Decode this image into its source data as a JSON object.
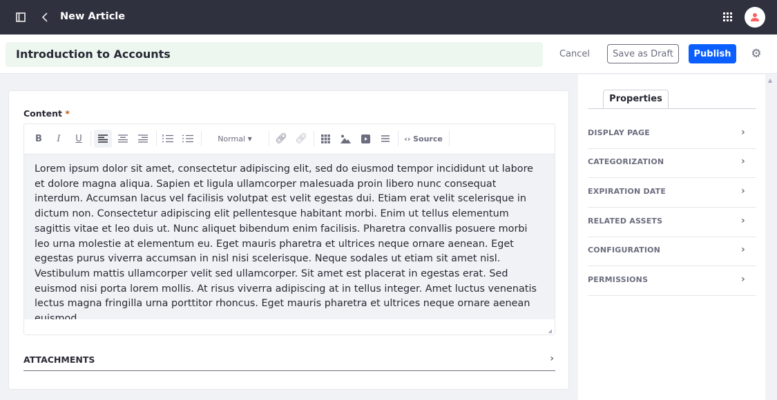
{
  "topbar": {
    "title": "New Article",
    "icons": [
      "sidebar-toggle-icon",
      "back-chevron-icon",
      "apps-grid-icon",
      "user-avatar-icon"
    ],
    "avatar_color": "#ff5f5f"
  },
  "header": {
    "title_value": "Introduction to Accounts",
    "cancel": "Cancel",
    "save_draft": "Save as Draft",
    "publish": "Publish",
    "accent": "#0b5fff"
  },
  "content": {
    "label": "Content",
    "required": "*",
    "format_select": "Normal",
    "source": "Source",
    "text": "Lorem ipsum dolor sit amet, consectetur adipiscing elit, sed do eiusmod tempor incididunt ut labore et dolore magna aliqua. Sapien et ligula ullamcorper malesuada proin libero nunc consequat interdum. Accumsan lacus vel facilisis volutpat est velit egestas dui. Etiam erat velit scelerisque in dictum non. Consectetur adipiscing elit pellentesque habitant morbi. Enim ut tellus elementum sagittis vitae et leo duis ut. Nunc aliquet bibendum enim facilisis. Pharetra convallis posuere morbi leo urna molestie at elementum eu. Eget mauris pharetra et ultrices neque ornare aenean. Eget egestas purus viverra accumsan in nisl nisi scelerisque. Neque sodales ut etiam sit amet nisl. Vestibulum mattis ullamcorper velit sed ullamcorper. Sit amet est placerat in egestas erat. Sed euismod nisi porta lorem mollis. At risus viverra adipiscing at in tellus integer. Amet luctus venenatis lectus magna fringilla urna porttitor rhoncus. Eget mauris pharetra et ultrices neque ornare aenean euismod.",
    "attachments": "ATTACHMENTS"
  },
  "panel": {
    "tab": "Properties",
    "items": [
      "DISPLAY PAGE",
      "CATEGORIZATION",
      "EXPIRATION DATE",
      "RELATED ASSETS",
      "CONFIGURATION",
      "PERMISSIONS"
    ]
  }
}
